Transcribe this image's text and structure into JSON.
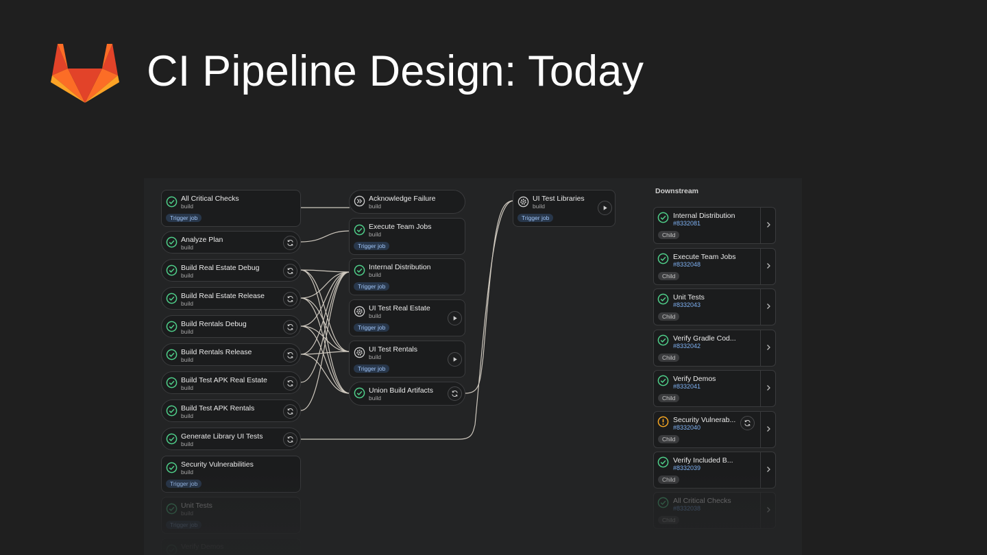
{
  "slide": {
    "title": "CI Pipeline Design: Today"
  },
  "colors": {
    "success": "#4fd08a",
    "warning": "#f5a623",
    "badge_text": "#9fc4f7",
    "link_text": "#7fb2f4"
  },
  "stage1": [
    {
      "name": "All Critical Checks",
      "stage": "build",
      "badge": "Trigger job",
      "action": ""
    },
    {
      "name": "Analyze Plan",
      "stage": "build",
      "badge": "",
      "action": "retry"
    },
    {
      "name": "Build Real Estate Debug",
      "stage": "build",
      "badge": "",
      "action": "retry"
    },
    {
      "name": "Build Real Estate Release",
      "stage": "build",
      "badge": "",
      "action": "retry"
    },
    {
      "name": "Build Rentals Debug",
      "stage": "build",
      "badge": "",
      "action": "retry"
    },
    {
      "name": "Build Rentals Release",
      "stage": "build",
      "badge": "",
      "action": "retry"
    },
    {
      "name": "Build Test APK Real Estate",
      "stage": "build",
      "badge": "",
      "action": "retry"
    },
    {
      "name": "Build Test APK Rentals",
      "stage": "build",
      "badge": "",
      "action": "retry"
    },
    {
      "name": "Generate Library UI Tests",
      "stage": "build",
      "badge": "",
      "action": "retry"
    },
    {
      "name": "Security Vulnerabilities",
      "stage": "build",
      "badge": "Trigger job",
      "action": ""
    },
    {
      "name": "Unit Tests",
      "stage": "build",
      "badge": "Trigger job",
      "action": ""
    },
    {
      "name": "Verify Demos",
      "stage": "",
      "badge": "",
      "action": ""
    }
  ],
  "stage2": [
    {
      "name": "Acknowledge Failure",
      "stage": "build",
      "badge": "",
      "status": "skipped"
    },
    {
      "name": "Execute Team Jobs",
      "stage": "build",
      "badge": "Trigger job",
      "status": "success"
    },
    {
      "name": "Internal Distribution",
      "stage": "build",
      "badge": "Trigger job",
      "status": "success"
    },
    {
      "name": "UI Test Real Estate",
      "stage": "build",
      "badge": "Trigger job",
      "status": "manual"
    },
    {
      "name": "UI Test Rentals",
      "stage": "build",
      "badge": "Trigger job",
      "status": "manual"
    },
    {
      "name": "Union Build Artifacts",
      "stage": "build",
      "badge": "",
      "status": "success"
    }
  ],
  "stage3": [
    {
      "name": "UI Test Libraries",
      "stage": "build",
      "badge": "Trigger job",
      "status": "manual"
    }
  ],
  "downstream": {
    "title": "Downstream",
    "items": [
      {
        "name": "Internal Distribution",
        "id": "#8332081",
        "tag": "Child",
        "status": "success"
      },
      {
        "name": "Execute Team Jobs",
        "id": "#8332048",
        "tag": "Child",
        "status": "success"
      },
      {
        "name": "Unit Tests",
        "id": "#8332043",
        "tag": "Child",
        "status": "success"
      },
      {
        "name": "Verify Gradle Cod...",
        "id": "#8332042",
        "tag": "Child",
        "status": "success"
      },
      {
        "name": "Verify Demos",
        "id": "#8332041",
        "tag": "Child",
        "status": "success"
      },
      {
        "name": "Security Vulnerab...",
        "id": "#8332040",
        "tag": "Child",
        "status": "warning"
      },
      {
        "name": "Verify Included B...",
        "id": "#8332039",
        "tag": "Child",
        "status": "success"
      },
      {
        "name": "All Critical Checks",
        "id": "#8332038",
        "tag": "Child",
        "status": "success"
      }
    ]
  }
}
